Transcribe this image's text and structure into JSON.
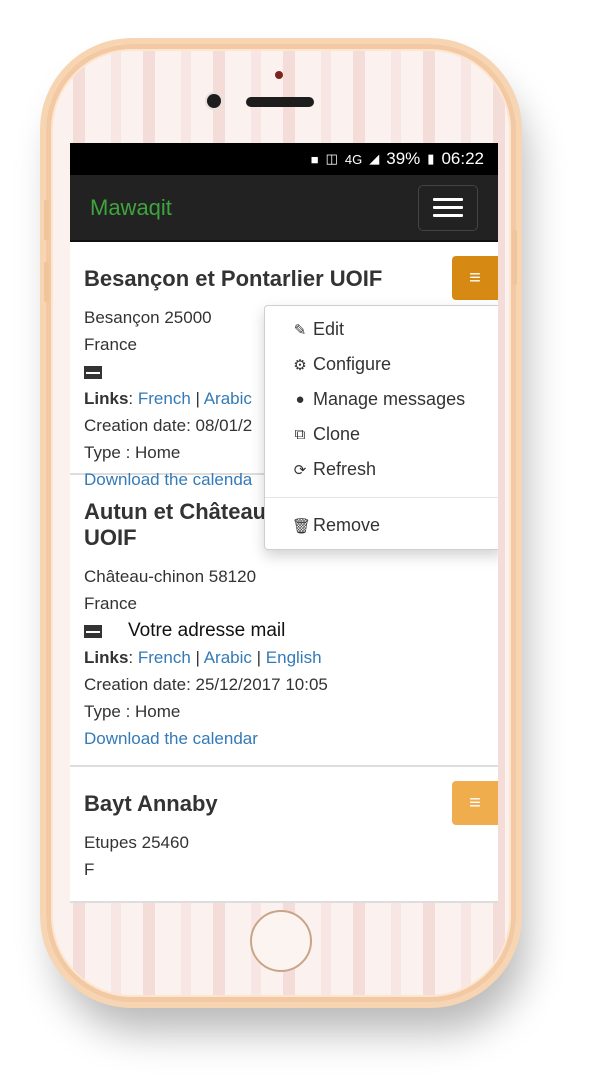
{
  "status_bar": {
    "network": "4G",
    "battery": "39%",
    "time": "06:22"
  },
  "navbar": {
    "brand": "Mawaqit"
  },
  "mosques": [
    {
      "name": "Besançon et Pontarlier UOIF",
      "city": "Besançon 25000",
      "country": "France",
      "email": "",
      "links_label": "Links",
      "links": [
        "French",
        "Arabic"
      ],
      "creation": "Creation date: 08/01/2",
      "type": "Type : Home",
      "download": "Download the calenda"
    },
    {
      "name": "Autun et Château-chinon UOIF",
      "city": "Château-chinon 58120",
      "country": "France",
      "email": "Votre adresse mail",
      "links_label": "Links",
      "links": [
        "French",
        "Arabic",
        "English"
      ],
      "creation": "Creation date: 25/12/2017 10:05",
      "type": "Type : Home",
      "download": "Download the calendar"
    },
    {
      "name": "Bayt Annaby",
      "city": "Etupes 25460",
      "country": "F"
    }
  ],
  "dropdown": {
    "items": [
      {
        "label": "Edit",
        "icon": "pencil-icon"
      },
      {
        "label": "Configure",
        "icon": "gear-icon"
      },
      {
        "label": "Manage messages",
        "icon": "comment-icon"
      },
      {
        "label": "Clone",
        "icon": "copy-icon"
      },
      {
        "label": "Refresh",
        "icon": "refresh-icon"
      }
    ],
    "remove_label": "Remove"
  },
  "colors": {
    "brand": "#3ea53e",
    "navbar_bg": "#222222",
    "link": "#337ab7",
    "menu_button": "#f0ad4e",
    "menu_button_active": "#d68a14"
  }
}
